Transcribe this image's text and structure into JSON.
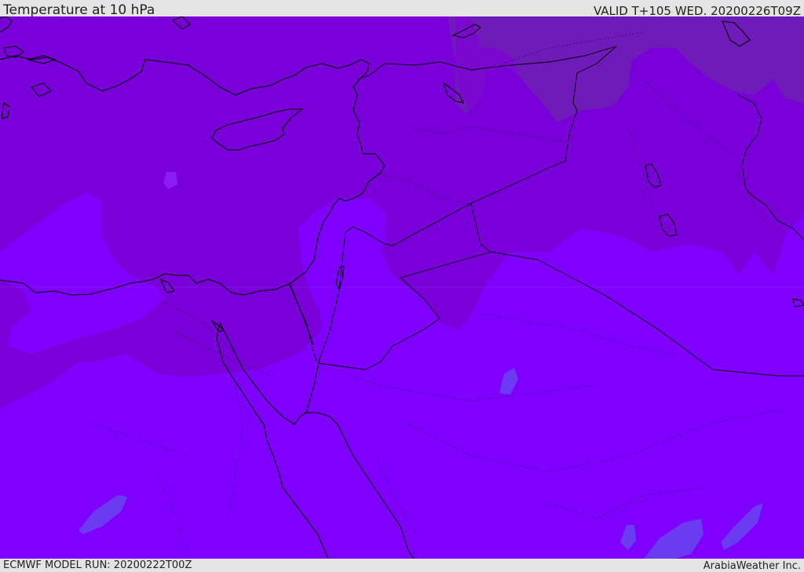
{
  "header": {
    "title": "Temperature at 10 hPa",
    "valid": "VALID T+105 WED. 20200226T09Z"
  },
  "footer": {
    "model_run": "ECMWF MODEL RUN: 20200222T00Z",
    "credit": "ArabiaWeather Inc."
  },
  "colors": {
    "bands": [
      "#6f1bb8",
      "#7a0ad8",
      "#8000ff",
      "#6a2ce8"
    ],
    "coastline": "#000000",
    "bar": "#e4e4e4"
  }
}
